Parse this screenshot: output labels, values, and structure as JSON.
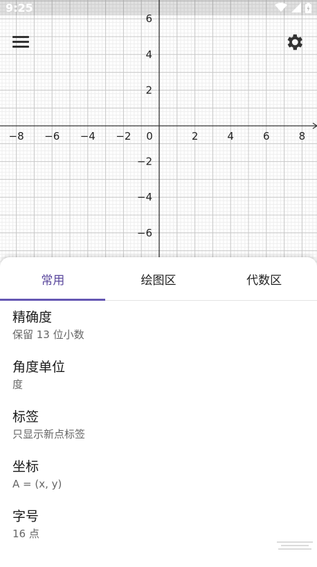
{
  "status_bar": {
    "time": "9:25"
  },
  "graph": {
    "x_ticks": [
      -8,
      -6,
      -4,
      -2,
      0,
      2,
      4,
      6,
      8
    ],
    "y_ticks": [
      6,
      4,
      2,
      -2,
      -4,
      -6
    ]
  },
  "toolbar": {
    "menu_icon": "menu-icon",
    "settings_icon": "gear-icon"
  },
  "tabs": [
    {
      "label": "常用"
    },
    {
      "label": "绘图区"
    },
    {
      "label": "代数区"
    }
  ],
  "settings": [
    {
      "title": "精确度",
      "value": "保留 13 位小数"
    },
    {
      "title": "角度单位",
      "value": "度"
    },
    {
      "title": "标签",
      "value": "只显示新点标签"
    },
    {
      "title": "坐标",
      "value": "A = (x, y)"
    },
    {
      "title": "字号",
      "value": "16 点"
    }
  ],
  "colors": {
    "accent": "#5c4a9e",
    "indicator": "#6557b3"
  }
}
